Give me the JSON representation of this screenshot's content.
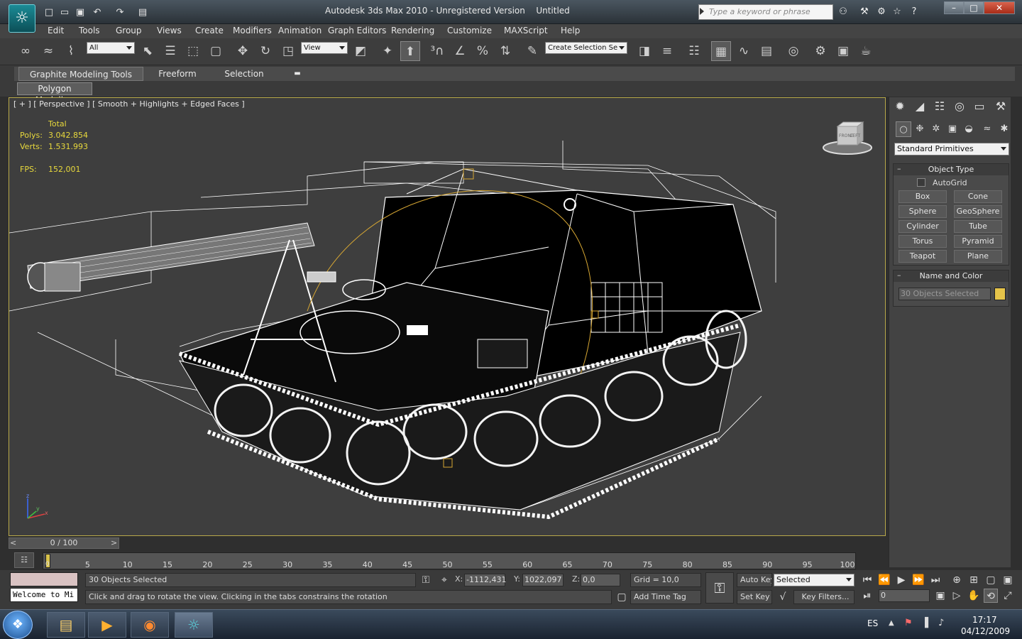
{
  "window": {
    "app": "Autodesk 3ds Max 2010",
    "edition": "- Unregistered Version",
    "file": "Untitled"
  },
  "search": {
    "placeholder": "Type a keyword or phrase"
  },
  "menu": [
    "Edit",
    "Tools",
    "Group",
    "Views",
    "Create",
    "Modifiers",
    "Animation",
    "Graph Editors",
    "Rendering",
    "Customize",
    "MAXScript",
    "Help"
  ],
  "toolbar": {
    "selection_filter": "All",
    "ref_coord": "View",
    "named_selection": "Create Selection Se"
  },
  "ribbon": {
    "tabs": [
      "Graphite Modeling Tools",
      "Freeform",
      "Selection"
    ],
    "panel": "Polygon Modeling"
  },
  "viewport": {
    "label": "[ + ] [ Perspective ] [ Smooth + Highlights + Edged Faces ]",
    "stats_header": "Total",
    "polys_label": "Polys:",
    "polys": "3.042.854",
    "verts_label": "Verts:",
    "verts": "1.531.993",
    "fps_label": "FPS:",
    "fps": "152,001",
    "viewcube_front": "FRONT",
    "viewcube_left": "LEFT",
    "axis_x": "x",
    "axis_y": "y",
    "axis_z": "z"
  },
  "command_panel": {
    "category": "Standard Primitives",
    "object_type_title": "Object Type",
    "autogrid": "AutoGrid",
    "buttons": [
      "Box",
      "Cone",
      "Sphere",
      "GeoSphere",
      "Cylinder",
      "Tube",
      "Torus",
      "Pyramid",
      "Teapot",
      "Plane"
    ],
    "name_color_title": "Name and Color",
    "name_value": "30 Objects Selected",
    "object_color": "#e6c44a"
  },
  "timeline": {
    "position": "0 / 100",
    "prev": "<",
    "next": ">",
    "ticks": [
      "5",
      "10",
      "15",
      "20",
      "25",
      "30",
      "35",
      "40",
      "45",
      "50",
      "55",
      "60",
      "65",
      "70",
      "75",
      "80",
      "85",
      "90",
      "95",
      "100"
    ],
    "zero": "0"
  },
  "status": {
    "script_text": "Welcome to Mi",
    "selection": "30 Objects Selected",
    "prompt": "Click and drag to rotate the view.  Clicking in the tabs constrains the rotation",
    "x_label": "X:",
    "x": "-1112,431",
    "y_label": "Y:",
    "y": "1022,097",
    "z_label": "Z:",
    "z": "0,0",
    "grid": "Grid = 10,0",
    "add_time_tag": "Add Time Tag",
    "auto_key": "Auto Key",
    "set_key": "Set Key",
    "key_mode": "Selected",
    "key_filters": "Key Filters...",
    "frame": "0"
  },
  "taskbar": {
    "lang": "ES",
    "time": "17:17",
    "date": "04/12/2009"
  }
}
